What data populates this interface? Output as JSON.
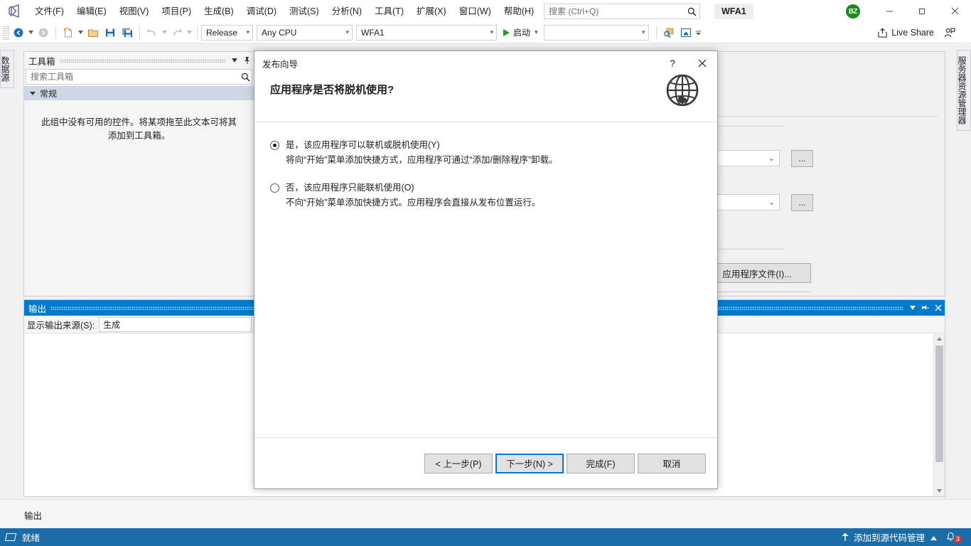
{
  "window": {
    "title": "WFA1",
    "minimize_label": "—",
    "maximize_label": "❐",
    "close_label": "✕"
  },
  "menu": {
    "items": [
      {
        "label": "文件(F)"
      },
      {
        "label": "编辑(E)"
      },
      {
        "label": "视图(V)"
      },
      {
        "label": "项目(P)"
      },
      {
        "label": "生成(B)"
      },
      {
        "label": "调试(D)"
      },
      {
        "label": "测试(S)"
      },
      {
        "label": "分析(N)"
      },
      {
        "label": "工具(T)"
      },
      {
        "label": "扩展(X)"
      },
      {
        "label": "窗口(W)"
      },
      {
        "label": "帮助(H)"
      }
    ]
  },
  "search": {
    "placeholder": "搜索 (Ctrl+Q)",
    "value": "",
    "icon": "search-icon"
  },
  "account": {
    "initials": "BZ",
    "color": "#1a8a1a"
  },
  "toolbar": {
    "configuration": "Release",
    "platform": "Any CPU",
    "startup_project": "WFA1",
    "run_label": "启动",
    "debug_target": "",
    "live_share_label": "Live Share"
  },
  "dock_tabs": {
    "left": "数据源",
    "right": "服务器资源管理器"
  },
  "toolbox": {
    "title": "工具箱",
    "search_placeholder": "搜索工具箱",
    "search_value": "",
    "group_label": "常规",
    "empty_message": "此组中没有可用的控件。将某项拖至此文本可将其添加到工具箱。"
  },
  "publish_page": {
    "app_files_button": "应用程序文件(I)...",
    "browse_button_label": "..."
  },
  "output": {
    "title": "输出",
    "source_label": "显示输出来源(S):",
    "source_value": "生成",
    "dropdown_icon": "chevron-down-icon",
    "pin_icon": "pin-icon",
    "close_icon": "close-icon",
    "content": ""
  },
  "bottom_tabs": {
    "items": [
      {
        "label": "输出"
      }
    ]
  },
  "statusbar": {
    "ready_label": "就绪",
    "source_control_label": "添加到源代码管理",
    "notification_count": "3",
    "accent": "#1a6ca8"
  },
  "dialog": {
    "title": "发布向导",
    "help_label": "?",
    "close_label": "✕",
    "heading": "应用程序是否将脱机使用?",
    "icon": "globe-icon",
    "options": [
      {
        "label": "是，该应用程序可以联机或脱机使用(Y)",
        "description": "将向“开始”菜单添加快捷方式，应用程序可通过“添加/删除程序”卸载。",
        "selected": true
      },
      {
        "label": "否，该应用程序只能联机使用(O)",
        "description": "不向“开始”菜单添加快捷方式。应用程序会直接从发布位置运行。",
        "selected": false
      }
    ],
    "buttons": {
      "previous": "< 上一步(P)",
      "next": "下一步(N) >",
      "finish": "完成(F)",
      "cancel": "取消"
    },
    "accent": "#0078d7"
  }
}
